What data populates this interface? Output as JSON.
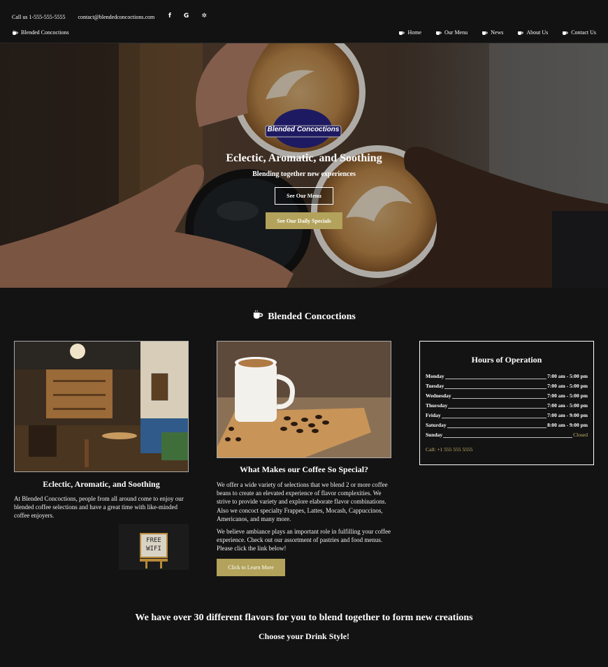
{
  "topbar": {
    "phone": "Call us 1-555-555-5555",
    "email": "contact@blendedconcoctions.com",
    "social": [
      {
        "name": "facebook-icon",
        "glyph": "f"
      },
      {
        "name": "google-icon",
        "glyph": "G"
      },
      {
        "name": "yelp-icon",
        "glyph": "✲"
      }
    ],
    "brand": "Blended Concoctions"
  },
  "nav": {
    "items": [
      {
        "label": "Home"
      },
      {
        "label": "Our Menu"
      },
      {
        "label": "News"
      },
      {
        "label": "About Us"
      },
      {
        "label": "Contact Us"
      }
    ]
  },
  "hero": {
    "title": "Eclectic, Aromatic, and Soothing",
    "subtitle": "Blending together new experiences",
    "menu_button": "See Our Menu",
    "specials_button": "See Our Daily Specials",
    "logo_text": "Blended Concoctions"
  },
  "section": {
    "title": "Blended Concoctions"
  },
  "left": {
    "heading": "Eclectic, Aromatic, and Soothing",
    "text": "At Blended Concoctions, people from all around come to enjoy our blended coffee selections and have a great time with like-minded coffee enjoyers.",
    "wifi_line1": "FREE",
    "wifi_line2": "WIFI"
  },
  "middle": {
    "heading": "What Makes our Coffee So Special?",
    "para1": "We offer a wide variety of selections that we blend 2 or more coffee beans to create an elevated experience of flavor complexities. We strive to provide variety and explore elaborate flavor combinations. Also we concoct specialty Frappes, Lattes, Mocash, Cappuccinos, Americanos, and many more.",
    "para2": "We believe ambiance plays an important role in fulfilling your coffee experience. Check out our assortment of pastries and food menus. Please click the link below!",
    "button": "Click to Learn More"
  },
  "hours": {
    "title": "Hours of Operation",
    "rows": [
      {
        "day": "Monday",
        "time": "7:00 am - 5:00 pm"
      },
      {
        "day": "Tuesday",
        "time": "7:00 am - 5:00 pm"
      },
      {
        "day": "Wednesday",
        "time": "7:00 am - 5:00 pm"
      },
      {
        "day": "Thursday",
        "time": "7:00 am - 5:00 pm"
      },
      {
        "day": "Friday",
        "time": "7:00 am - 9:00 pm"
      },
      {
        "day": "Saturday",
        "time": "8:00 am - 9:00 pm"
      },
      {
        "day": "Sunday",
        "time": "Closed"
      }
    ],
    "call": "Call: +1 555 555 5555"
  },
  "bottom": {
    "heading": "We have over 30 different flavors for you to blend together to form new creations",
    "subheading": "Choose your Drink Style!"
  },
  "colors": {
    "background": "#141313",
    "accent_gold": "#b2a25b",
    "closed_text": "#c7b56a"
  }
}
